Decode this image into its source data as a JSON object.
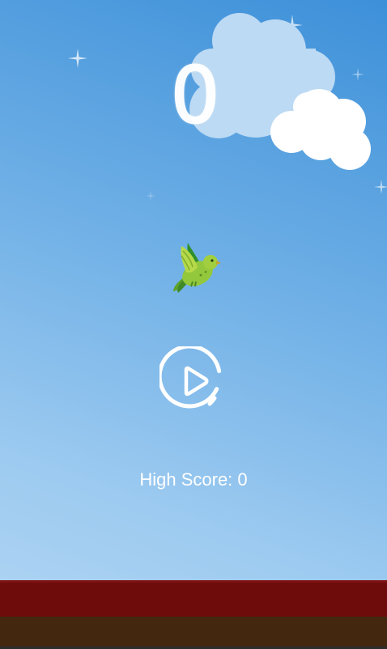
{
  "game": {
    "score": "0",
    "high_score_label": "High Score: 0",
    "high_score_value": 0
  },
  "icons": {
    "bird": "green-bird-icon",
    "play": "play-icon"
  },
  "colors": {
    "sky_top": "#3d90d9",
    "sky_bottom": "#b3d6f3",
    "ground_top": "#6e0c0c",
    "ground_bottom": "#43280f",
    "bird": "#8cc63f"
  }
}
